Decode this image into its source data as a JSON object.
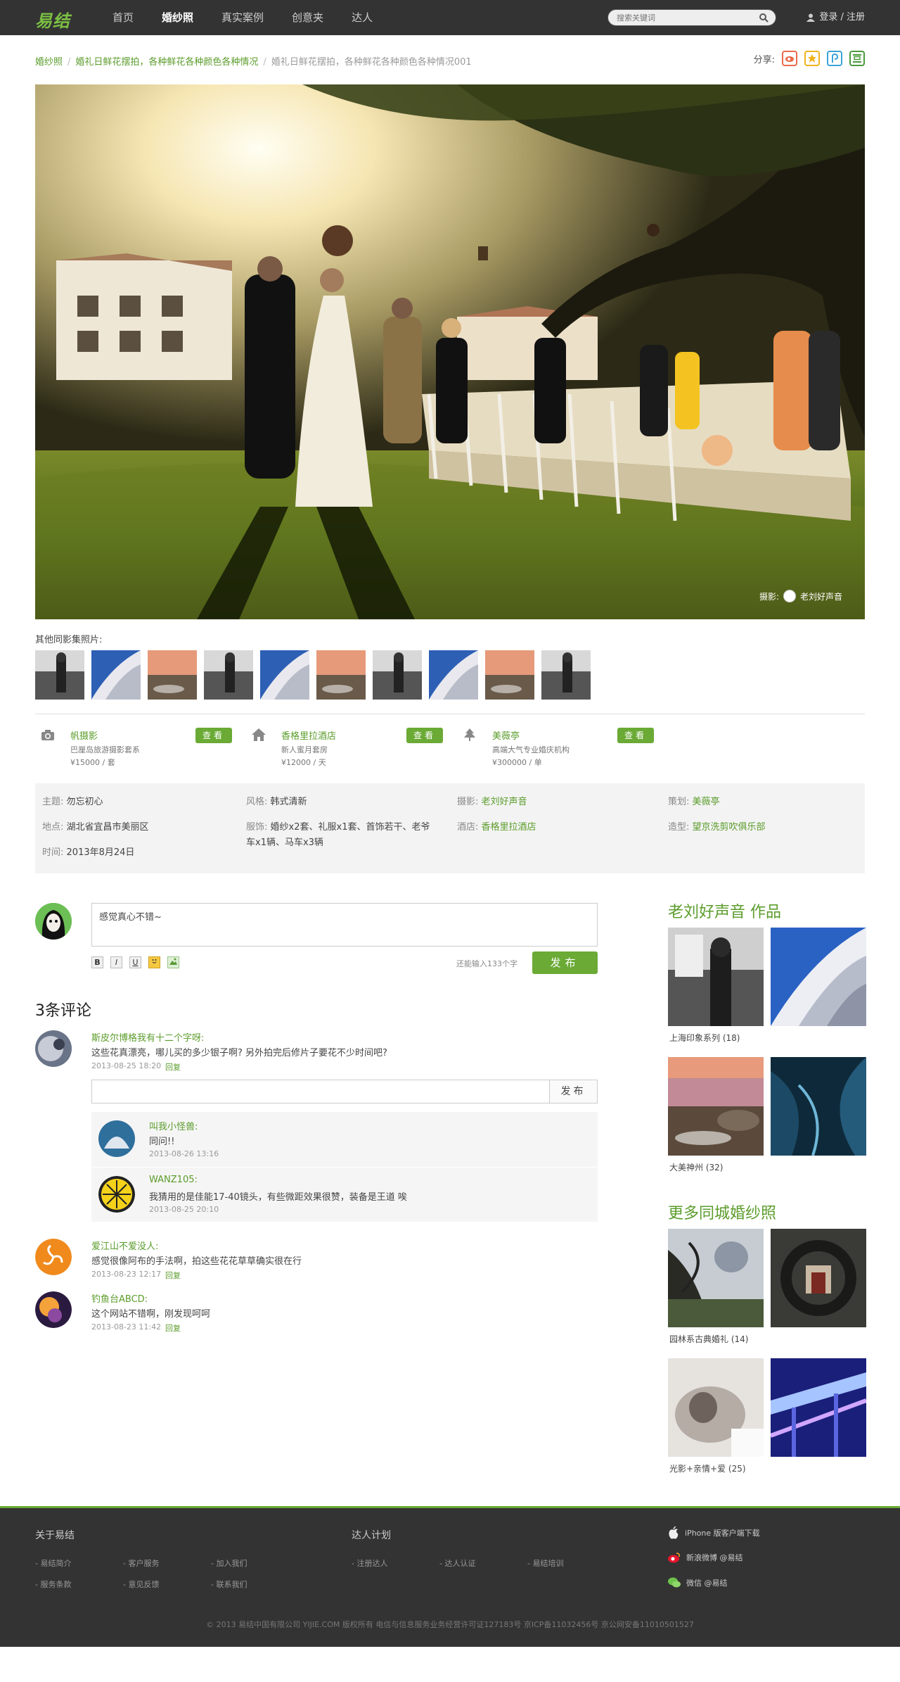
{
  "nav": {
    "logo": "易结",
    "links": [
      "首页",
      "婚纱照",
      "真实案例",
      "创意夹",
      "达人"
    ],
    "search_placeholder": "搜索关键词",
    "login": "登录 / 注册"
  },
  "breadcrumb": [
    "婚纱照",
    "婚礼日鲜花摆拍，各种鲜花各种颜色各种情况",
    "婚礼日鲜花摆拍，各种鲜花各种颜色各种情况001"
  ],
  "share": {
    "label": "分享:",
    "icons": [
      "weibo-icon",
      "qzone-icon",
      "tencent-icon",
      "douban-icon"
    ]
  },
  "hero": {
    "credit_label": "摄影:",
    "credit_name": "老刘好声音"
  },
  "others_label": "其他同影集照片:",
  "vendors": [
    {
      "icon": "camera-icon",
      "name": "帆摄影",
      "desc": "巴厘岛旅游摄影套系",
      "price": "¥15000 / 套",
      "button": "查看"
    },
    {
      "icon": "house-icon",
      "name": "香格里拉酒店",
      "desc": "新人蜜月套房",
      "price": "¥12000 / 天",
      "button": "查看"
    },
    {
      "icon": "tree-icon",
      "name": "美薇亭",
      "desc": "高端大气专业婚庆机构",
      "price": "¥300000 / 单",
      "button": "查看"
    }
  ],
  "info": {
    "theme_label": "主题:",
    "theme": "勿忘初心",
    "style_label": "风格:",
    "style": "韩式清新",
    "photo_label": "摄影:",
    "photo": "老刘好声音",
    "plan_label": "策划:",
    "plan": "美薇亭",
    "place_label": "地点:",
    "place": "湖北省宜昌市美丽区",
    "dress_label": "服饰:",
    "dress_line1": "婚纱x2套、礼服x1套、首饰若干、老爷",
    "dress_line2": "车x1辆、马车x3辆",
    "hotel_label": "酒店:",
    "hotel": "香格里拉酒店",
    "styling_label": "造型:",
    "styling": "望京洗剪吹俱乐部",
    "time_label": "时间:",
    "time": "2013年8月24日"
  },
  "comment_box": {
    "value": "感觉真心不错~",
    "remain": "还能输入133个字",
    "post": "发布",
    "tools": [
      "B",
      "I",
      "U"
    ]
  },
  "comments_count": "3条评论",
  "comments": [
    {
      "name": "斯皮尔博格我有十二个字呀:",
      "text": "这些花真漂亮，哪儿买的多少银子啊? 另外拍完后修片子要花不少时间吧?",
      "time": "2013-08-25 18:20",
      "reply": "回复"
    },
    {
      "name": "爱江山不爱没人:",
      "text": "感觉很像阿布的手法啊，拍这些花花草草确实很在行",
      "time": "2013-08-23 12:17",
      "reply": "回复"
    },
    {
      "name": "钓鱼台ABCD:",
      "text": "这个网站不错啊，刚发现呵呵",
      "time": "2013-08-23 11:42",
      "reply": "回复"
    }
  ],
  "reply_box": {
    "button": "发布"
  },
  "sub_comments": [
    {
      "name": "叫我小怪兽:",
      "text": "同问!!",
      "time": "2013-08-26 13:16"
    },
    {
      "name": "WANZ105:",
      "text": "我猜用的是佳能17-40镜头，有些微距效果很赞，装备是王道 唉",
      "time": "2013-08-25 20:10"
    }
  ],
  "sidebar": {
    "works_title": "老刘好声音 作品",
    "works": [
      {
        "caption": "上海印象系列 (18)"
      },
      {
        "caption": "大美神州 (32)"
      }
    ],
    "more_title": "更多同城婚纱照",
    "more": [
      {
        "caption": "园林系古典婚礼 (14)"
      },
      {
        "caption": "光影+亲情+爱 (25)"
      }
    ]
  },
  "footer": {
    "about_title": "关于易结",
    "about_links": [
      "- 易结简介",
      "- 客户服务",
      "- 加入我们",
      "- 服务条款",
      "- 意见反馈",
      "- 联系我们"
    ],
    "daren_title": "达人计划",
    "daren_links": [
      "- 注册达人",
      "- 达人认证",
      "- 易结培训"
    ],
    "apps": [
      "iPhone 版客户端下载",
      "新浪微博 @易结",
      "微信 @易结"
    ],
    "copyright": "© 2013  易结中国有限公司 YIJIE.COM  版权所有    电信与信息服务业务经营许可证127183号    京ICP备11032456号    京公网安备11010501527"
  },
  "colors": {
    "accent": "#6aaa35",
    "link": "#5b9c2b",
    "topbar": "#333333"
  }
}
